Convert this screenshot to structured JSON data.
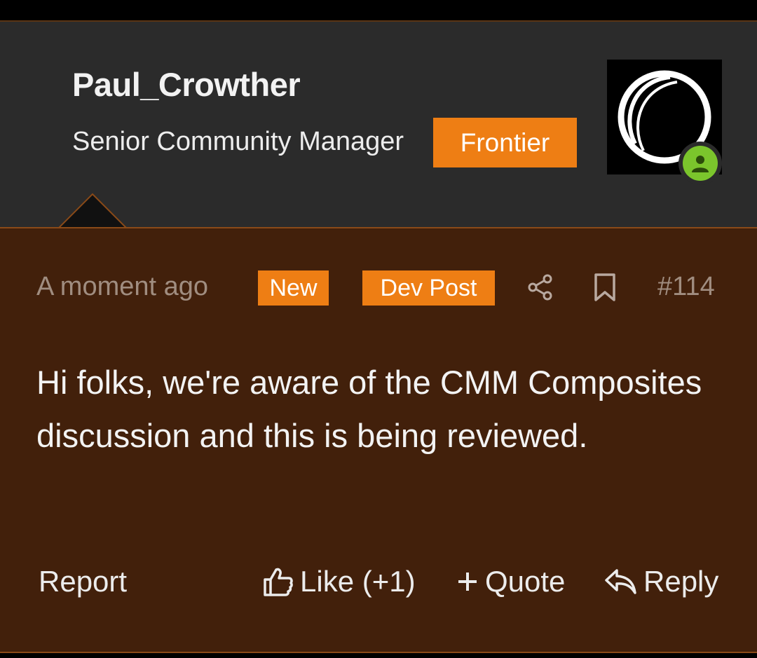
{
  "author": {
    "name": "Paul_Crowther",
    "title": "Senior Community Manager",
    "group_badge": "Frontier"
  },
  "meta": {
    "time": "A moment ago",
    "tags": [
      "New",
      "Dev Post"
    ],
    "post_number": "#114"
  },
  "body": "Hi folks, we're aware of the CMM Composites discussion and this is being reviewed.",
  "actions": {
    "report": "Report",
    "like": "Like (+1)",
    "quote": "Quote",
    "reply": "Reply"
  },
  "icons": {
    "share": "share-icon",
    "bookmark": "bookmark-icon",
    "like": "thumbs-up-icon",
    "quote": "plus-icon",
    "reply": "reply-icon",
    "online": "user-online-icon"
  },
  "colors": {
    "header_bg": "#2b2b2b",
    "post_bg": "#42200b",
    "accent": "#ee7e14",
    "online": "#7bc52c"
  }
}
